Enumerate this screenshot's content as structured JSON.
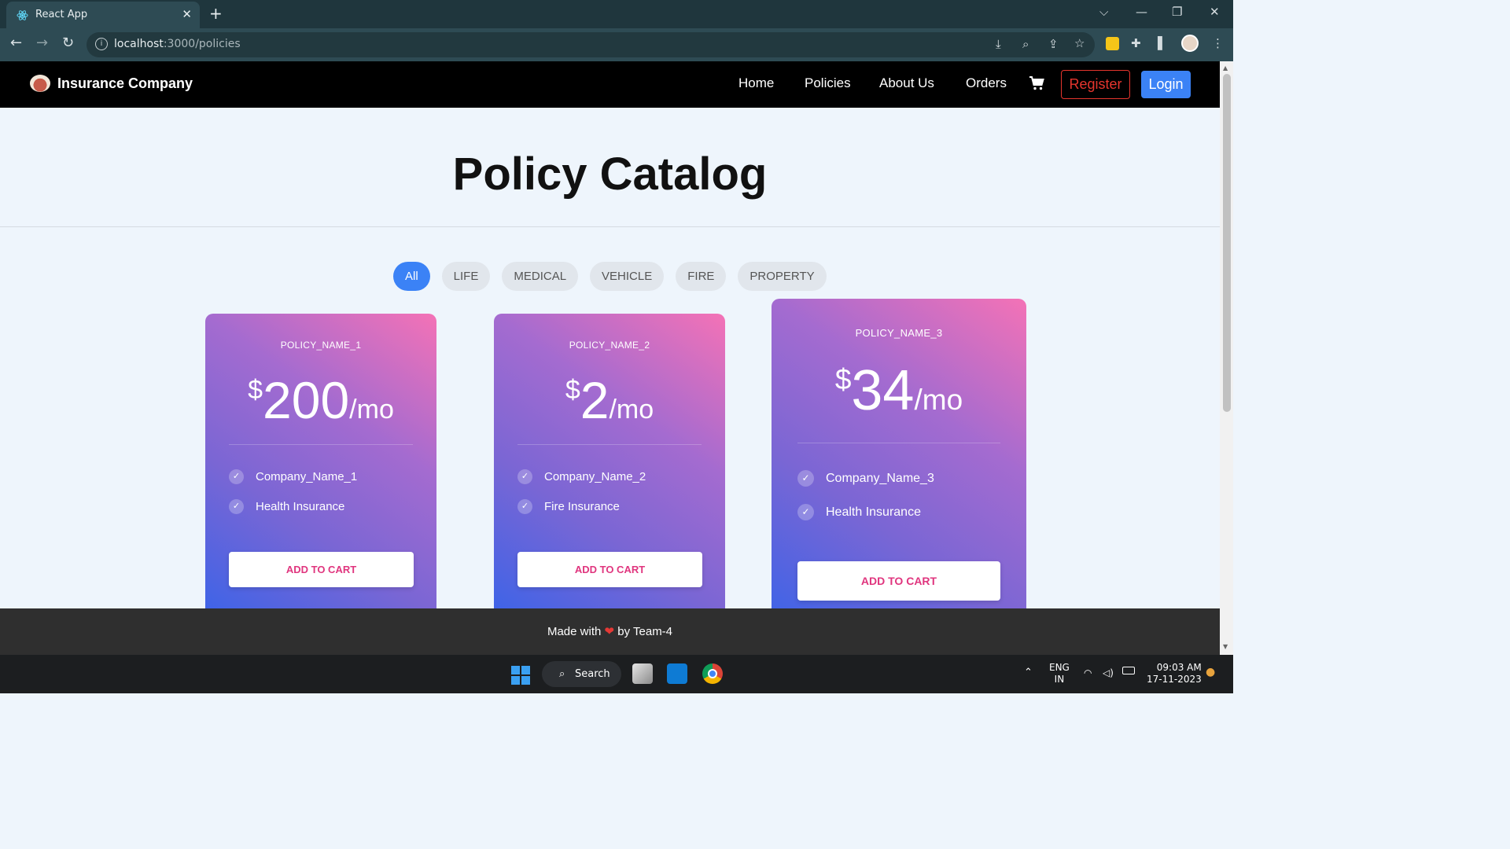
{
  "browser": {
    "tab_title": "React App",
    "tab_close": "✕",
    "new_tab": "+",
    "url_host": "localhost",
    "url_path": ":3000/policies",
    "win_minimize": "—",
    "win_restore": "❐",
    "win_close": "✕",
    "tab_list": "⌵"
  },
  "site": {
    "brand": "Insurance Company",
    "nav": [
      "Home",
      "Policies",
      "About Us",
      "Orders"
    ],
    "register": "Register",
    "login": "Login"
  },
  "page": {
    "title": "Policy Catalog",
    "filters": [
      "All",
      "LIFE",
      "MEDICAL",
      "VEHICLE",
      "FIRE",
      "PROPERTY"
    ],
    "active_filter": "All"
  },
  "policies": [
    {
      "name": "POLICY_NAME_1",
      "currency": "$",
      "price": "200",
      "period": "/mo",
      "company": "Company_Name_1",
      "type": "Health Insurance",
      "cta": "ADD TO CART"
    },
    {
      "name": "POLICY_NAME_2",
      "currency": "$",
      "price": "2",
      "period": "/mo",
      "company": "Company_Name_2",
      "type": "Fire Insurance",
      "cta": "ADD TO CART"
    },
    {
      "name": "POLICY_NAME_3",
      "currency": "$",
      "price": "34",
      "period": "/mo",
      "company": "Company_Name_3",
      "type": "Health Insurance",
      "cta": "ADD TO CART"
    }
  ],
  "footer": {
    "before": "Made with",
    "heart": "❤",
    "after": "by Team-4"
  },
  "taskbar": {
    "search": "Search",
    "lang": "ENG",
    "region": "IN",
    "time": "09:03 AM",
    "date": "17-11-2023"
  },
  "colors": {
    "accent": "#3b82f6",
    "register": "#e5352d",
    "cta_text": "#e0357e",
    "card_top": "#f472b6",
    "card_bottom": "#3b63e8"
  }
}
